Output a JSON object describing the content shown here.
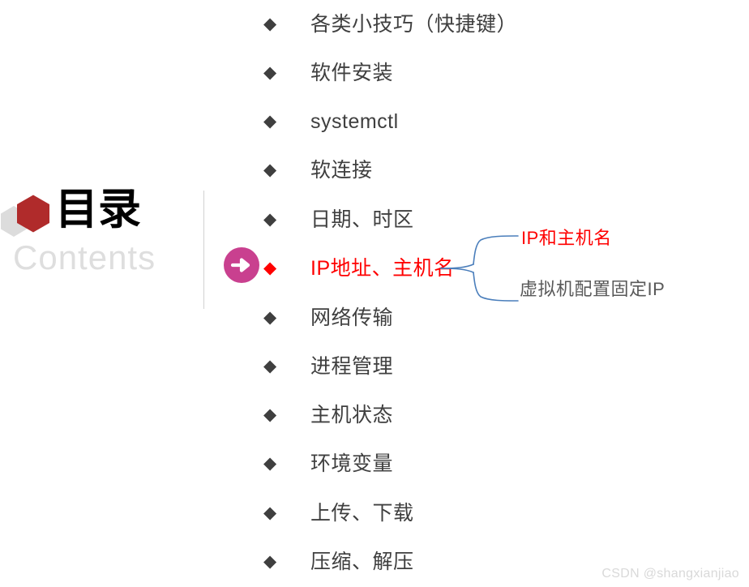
{
  "slide": {
    "title_cn": "目录",
    "title_en": "Contents",
    "logo_icon": "hexagon-logo",
    "logo_colors": {
      "primary": "#B02B2B",
      "secondary": "#DCDCDC"
    },
    "background": "#FFFFFF",
    "divider_color": "#D2D2D2"
  },
  "colors": {
    "text_default": "#3F3F3F",
    "text_highlight": "#FF0000",
    "annotation_gray": "#595959",
    "marker_circle": "#C9408F",
    "brace_line": "#4A7EBB",
    "watermark": "#D9D9D9"
  },
  "toc": {
    "bullet_glyph": "◆",
    "current_index": 5,
    "items": [
      {
        "label": "各类小技巧（快捷键）"
      },
      {
        "label": "软件安装"
      },
      {
        "label": "systemctl"
      },
      {
        "label": "软连接"
      },
      {
        "label": "日期、时区"
      },
      {
        "label": "IP地址、主机名"
      },
      {
        "label": "网络传输"
      },
      {
        "label": "进程管理"
      },
      {
        "label": "主机状态"
      },
      {
        "label": "环境变量"
      },
      {
        "label": "上传、下载"
      },
      {
        "label": "压缩、解压"
      }
    ]
  },
  "marker": {
    "icon": "arrow-right-circle-icon"
  },
  "branch": {
    "brace_icon": "curly-brace-icon",
    "items": [
      {
        "label": "IP和主机名",
        "color": "#FF0000"
      },
      {
        "label": "虚拟机配置固定IP",
        "color": "#595959"
      }
    ]
  },
  "watermark": {
    "text": "CSDN @shangxianjiao"
  }
}
